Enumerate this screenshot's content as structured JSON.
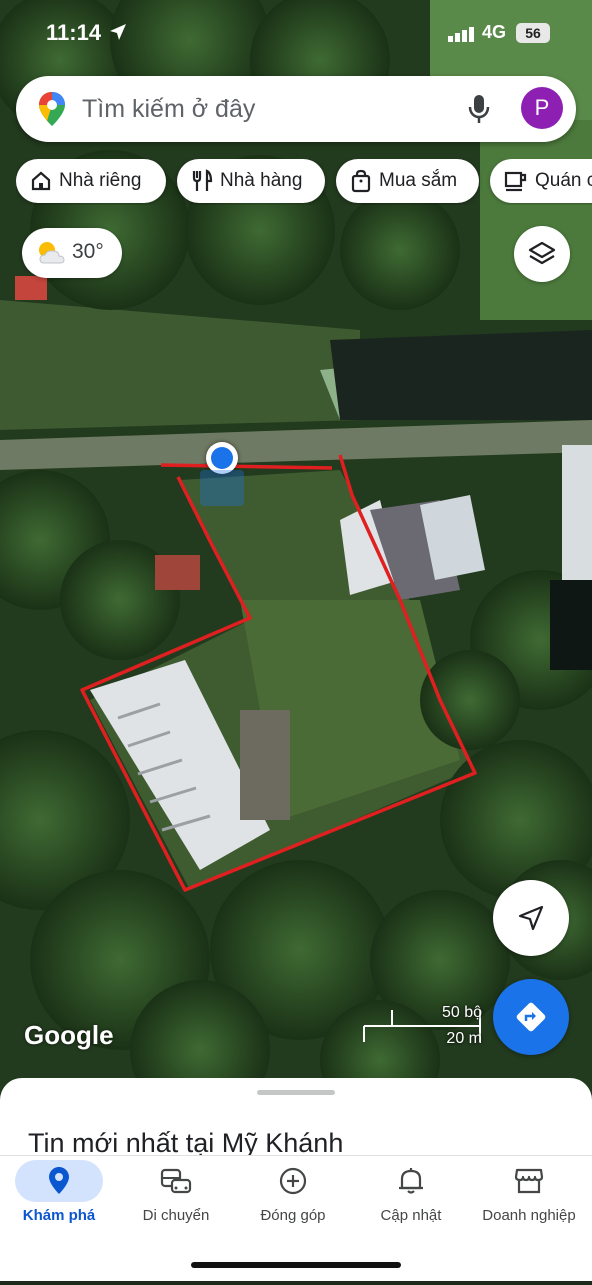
{
  "status_bar": {
    "time": "11:14",
    "network": "4G",
    "battery": "56"
  },
  "search": {
    "placeholder": "Tìm kiếm ở đây",
    "avatar_letter": "P"
  },
  "chips": [
    {
      "label": "Nhà riêng",
      "icon": "home-icon"
    },
    {
      "label": "Nhà hàng",
      "icon": "restaurant-icon"
    },
    {
      "label": "Mua sắm",
      "icon": "shopping-bag-icon"
    },
    {
      "label": "Quán c",
      "icon": "coffee-icon"
    }
  ],
  "weather": {
    "temperature": "30°",
    "icon": "partly-sunny-icon"
  },
  "map": {
    "attribution": "Google",
    "scale_imperial": "50 bộ",
    "scale_metric": "20 m",
    "boundary_color": "#e02020",
    "location_dot_color": "#1a73e8"
  },
  "sheet": {
    "title": "Tin mới nhất tại Mỹ Khánh"
  },
  "bottom_nav": [
    {
      "label": "Khám phá",
      "icon": "explore-pin-icon",
      "active": true
    },
    {
      "label": "Di chuyển",
      "icon": "commute-icon",
      "active": false
    },
    {
      "label": "Đóng góp",
      "icon": "contribute-plus-icon",
      "active": false
    },
    {
      "label": "Cập nhật",
      "icon": "bell-icon",
      "active": false
    },
    {
      "label": "Doanh nghiệp",
      "icon": "storefront-icon",
      "active": false
    }
  ],
  "colors": {
    "accent": "#1a73e8",
    "active_nav_bg": "#d3e3fd",
    "avatar_bg": "#8e1fb3"
  }
}
